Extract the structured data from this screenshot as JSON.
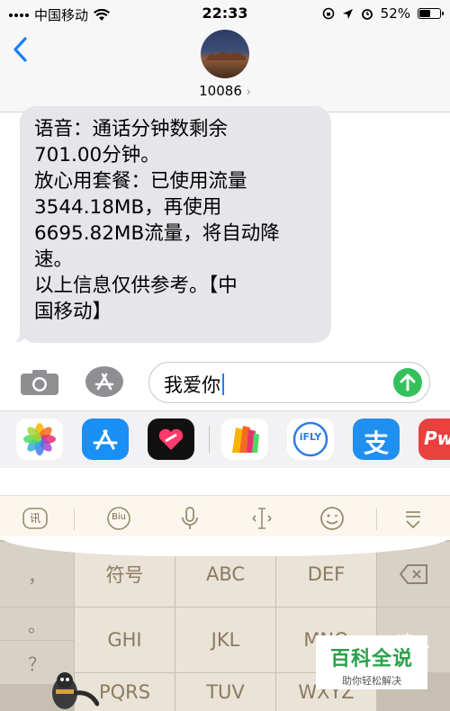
{
  "status_bar": {
    "carrier": "中国移动",
    "time": "22:33",
    "battery": "52%",
    "battery_level": 0.52
  },
  "header": {
    "back_icon": "chevron-left-icon",
    "contact_name": "10086",
    "contact_chevron": "›"
  },
  "message": {
    "text": "语音：通话分钟数剩余\n701.00分钟。\n放心用套餐：已使用流量\n3544.18MB，再使用\n6695.82MB流量，将自动降\n速。\n以上信息仅供参考。【中\n国移动】"
  },
  "compose": {
    "input_value": "我爱你",
    "send_color": "#34c05a"
  },
  "app_drawer": {
    "apps": [
      "photos-icon",
      "app-store-icon",
      "heart-app-icon",
      "books-icon",
      "ifly-icon",
      "alipay-icon",
      "pw-app-icon"
    ],
    "ifly_label": "iFLY",
    "alipay_label": "支",
    "pw_label": "Pw"
  },
  "keyboard": {
    "toolbar": [
      "ifly-logo-icon",
      "biu-icon",
      "microphone-icon",
      "cursor-icon",
      "emoji-icon",
      "hide-keyboard-icon"
    ],
    "logo_label": "讯",
    "biu_label": "Biu",
    "left_column": [
      "，",
      "。",
      "？"
    ],
    "keys": {
      "symbols": "符号",
      "abc": "ABC",
      "def": "DEF",
      "ghi": "GHI",
      "jkl": "JKL",
      "mno": "MNO",
      "pqrs": "PQRS",
      "tuv": "TUV",
      "wxyz": "WXYZ",
      "right_partial": "速..."
    }
  },
  "watermark": {
    "title": "百科全说",
    "subtitle": "助你轻松解决"
  }
}
